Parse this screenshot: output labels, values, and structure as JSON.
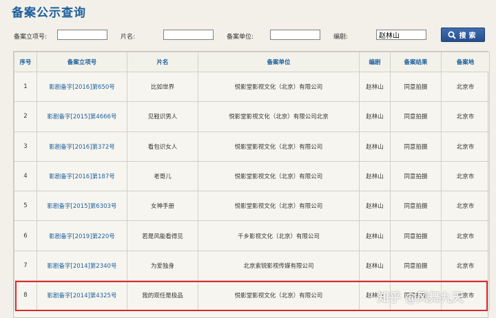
{
  "page": {
    "title": "备案公示查询"
  },
  "search": {
    "labels": {
      "id": "备案立项号:",
      "film": "片名:",
      "unit": "备案单位:",
      "writer": "编剧:"
    },
    "values": {
      "id": "",
      "film": "",
      "unit": "",
      "writer": "赵林山"
    },
    "button": "搜索"
  },
  "table": {
    "headers": [
      "序号",
      "备案立项号",
      "片名",
      "备案单位",
      "编剧",
      "备案结果",
      "备案地"
    ],
    "rows": [
      [
        "1",
        "影剧备字[2016]第650号",
        "比如世界",
        "悦影堂影视文化（北京）有限公司",
        "赵林山",
        "同意拍摄",
        "北京市"
      ],
      [
        "2",
        "影剧备字[2015]第4666号",
        "见鞋识男人",
        "悦影堂影视文化（北京）有限公司北京",
        "赵林山",
        "同意拍摄",
        "北京市"
      ],
      [
        "3",
        "影剧备字[2016]第372号",
        "看包识女人",
        "悦影堂影视文化（北京）有限公司",
        "赵林山",
        "同意拍摄",
        "北京市"
      ],
      [
        "4",
        "影剧备字[2016]第187号",
        "老哥儿",
        "悦影堂影视文化（北京）有限公司",
        "赵林山",
        "同意拍摄",
        "北京市"
      ],
      [
        "5",
        "影剧备字[2015]第6303号",
        "女神手册",
        "悦影堂影视文化（北京）有限公司",
        "赵林山",
        "同意拍摄",
        "北京市"
      ],
      [
        "6",
        "影剧备字[2019]第220号",
        "若是风能看得见",
        "千乡影视文化（北京）有限公司",
        "赵林山",
        "同意拍摄",
        "北京市"
      ],
      [
        "7",
        "影剧备字[2014]第2340号",
        "为爱独身",
        "北京索锐影视传媒有限公司",
        "赵林山",
        "同意拍摄",
        "北京市"
      ],
      [
        "8",
        "影剧备字[2014]第4325号",
        "我的现任是极品",
        "悦影堂影视文化（北京）有限公司",
        "赵林山",
        "同意拍摄",
        "北京市"
      ]
    ]
  },
  "watermark": "知乎 @风舞九天",
  "colors": {
    "accent": "#1d5f9e",
    "highlight": "#e0282d",
    "button": "#2f5c9c"
  }
}
